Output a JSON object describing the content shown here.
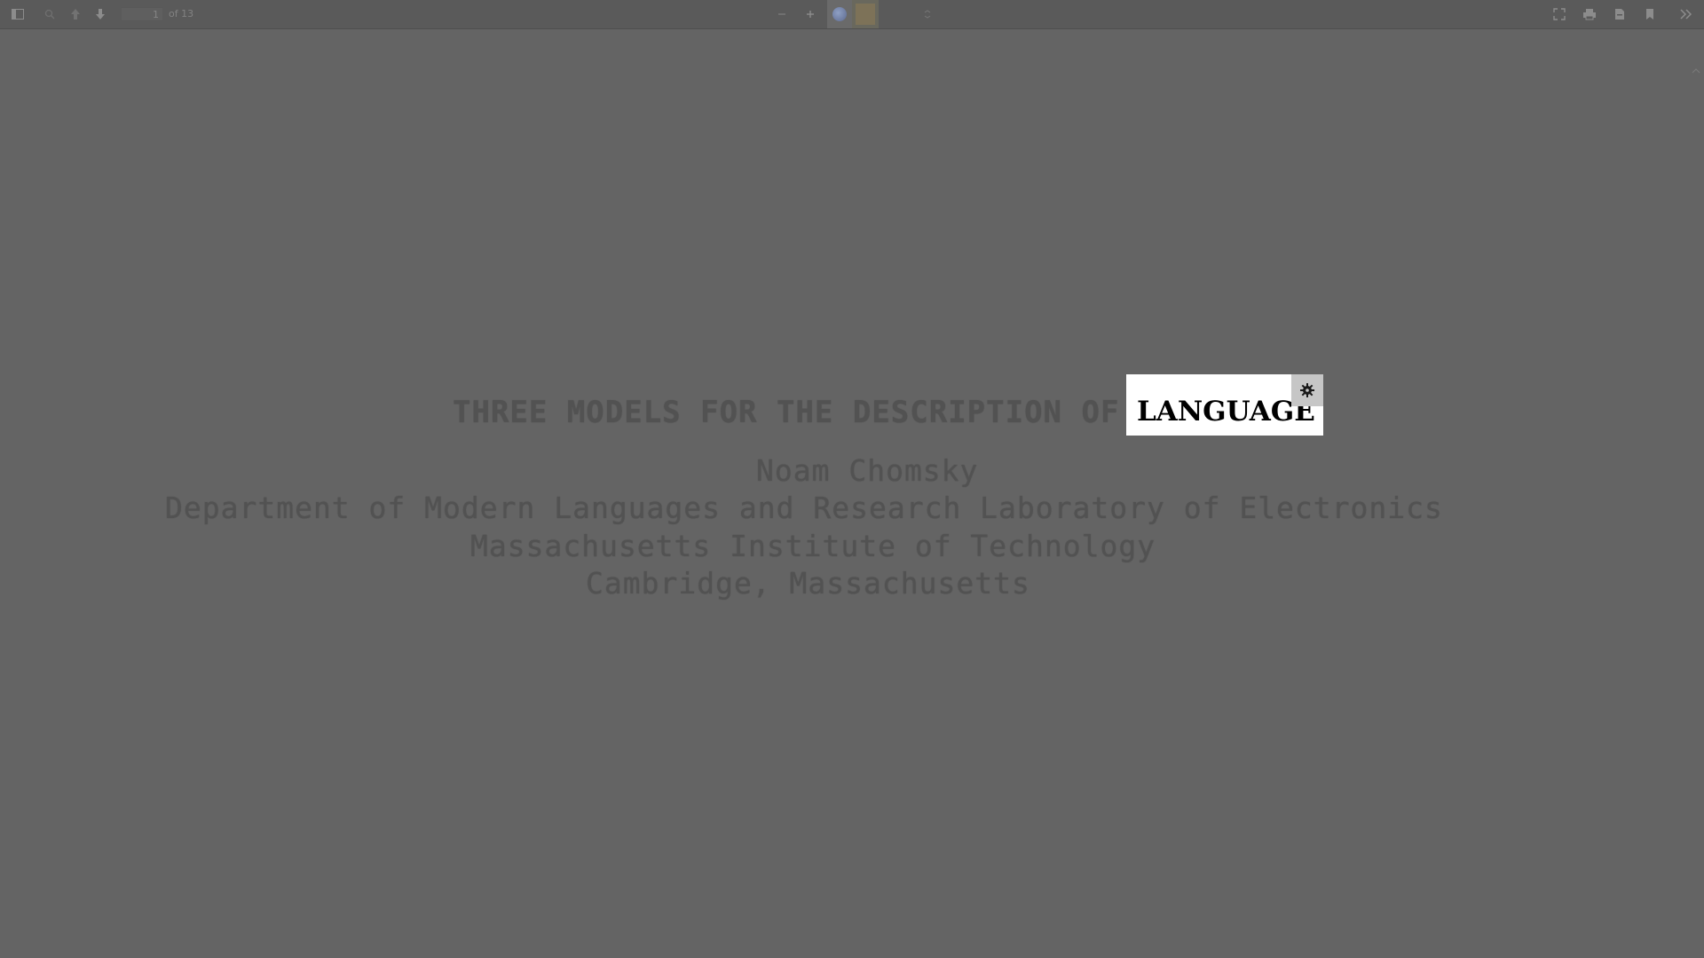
{
  "toolbar": {
    "page_number": "1",
    "page_count": "of 13",
    "zoom_label": ""
  },
  "document": {
    "title_prefix": "THREE MODELS FOR THE DESCRIPTION OF",
    "title_highlight": "LANGUAGE",
    "author": "Noam Chomsky",
    "department": "Department of Modern Languages and Research Laboratory of Electronics",
    "institute": "Massachusetts Institute of Technology",
    "city": "Cambridge, Massachusetts"
  },
  "colors": {
    "background": "#646464",
    "toolbar": "#5a5a5a",
    "highlight": "#ffffff"
  }
}
